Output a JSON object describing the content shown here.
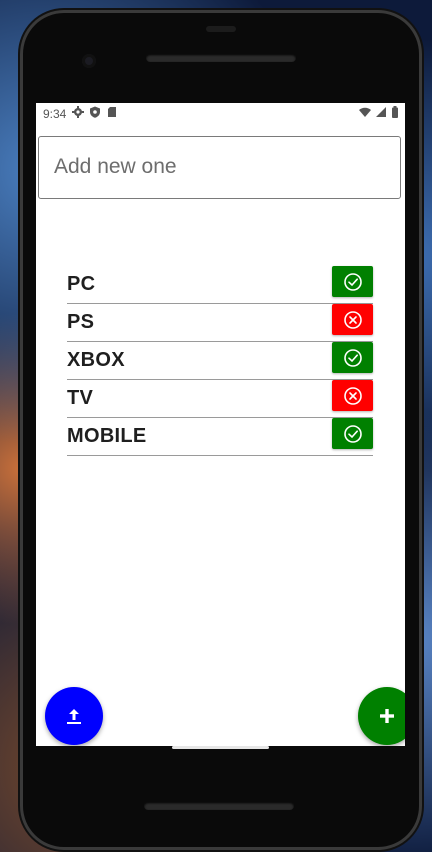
{
  "status_bar": {
    "time": "9:34",
    "left_icons": [
      "settings-icon",
      "shield-icon",
      "sd-card-icon"
    ],
    "right_icons": [
      "wifi-icon",
      "cell-signal-icon",
      "battery-icon"
    ]
  },
  "new_item_input": {
    "placeholder": "Add new one",
    "value": ""
  },
  "items": [
    {
      "label": "PC",
      "status": "done",
      "icon": "check-circle-icon",
      "color": "#008000"
    },
    {
      "label": "PS",
      "status": "not-done",
      "icon": "x-circle-icon",
      "color": "#ff0000"
    },
    {
      "label": "XBOX",
      "status": "done",
      "icon": "check-circle-icon",
      "color": "#008000"
    },
    {
      "label": "TV",
      "status": "not-done",
      "icon": "x-circle-icon",
      "color": "#ff0000"
    },
    {
      "label": "MOBILE",
      "status": "done",
      "icon": "check-circle-icon",
      "color": "#008000"
    }
  ],
  "fabs": {
    "upload": {
      "icon": "upload-icon",
      "color": "#0000ff"
    },
    "add": {
      "icon": "plus-icon",
      "color": "#008000"
    }
  }
}
